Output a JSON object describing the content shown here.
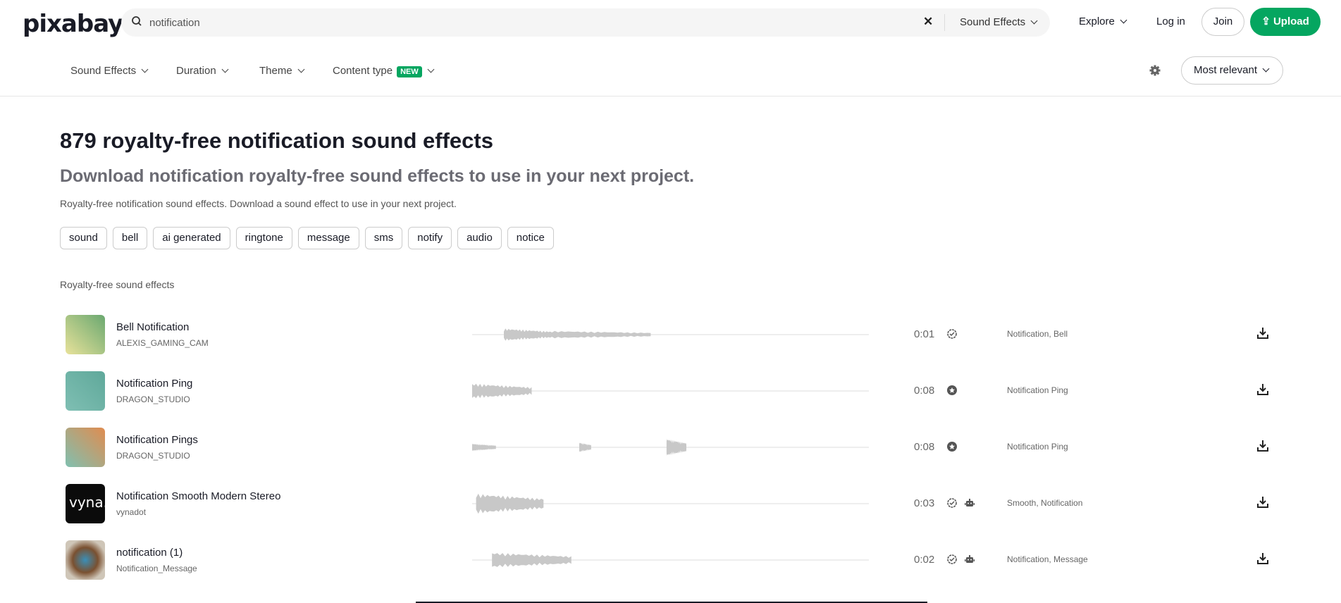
{
  "header": {
    "logo": "pixabay",
    "search_value": "notification",
    "search_category": "Sound Effects",
    "explore": "Explore",
    "login": "Log in",
    "join": "Join",
    "upload": "Upload"
  },
  "filters": {
    "items": [
      "Sound Effects",
      "Duration",
      "Theme",
      "Content type"
    ],
    "new_badge": "NEW",
    "sort": "Most relevant"
  },
  "main": {
    "title": "879 royalty-free notification sound effects",
    "subtitle": "Download notification royalty-free sound effects to use in your next project.",
    "description": "Royalty-free notification sound effects. Download a sound effect to use in your next project.",
    "tags": [
      "sound",
      "bell",
      "ai generated",
      "ringtone",
      "message",
      "sms",
      "notify",
      "audio",
      "notice"
    ],
    "section_label": "Royalty-free sound effects",
    "tracks": [
      {
        "title": "Bell Notification",
        "author": "ALEXIS_GAMING_CAM",
        "duration": "0:01",
        "tags": "Notification, Bell",
        "badge": "verified",
        "ai": false
      },
      {
        "title": "Notification Ping",
        "author": "DRAGON_STUDIO",
        "duration": "0:08",
        "tags": "Notification Ping",
        "badge": "star",
        "ai": false
      },
      {
        "title": "Notification Pings",
        "author": "DRAGON_STUDIO",
        "duration": "0:08",
        "tags": "Notification Ping",
        "badge": "star",
        "ai": false
      },
      {
        "title": "Notification Smooth Modern Stereo",
        "author": "vynadot",
        "duration": "0:03",
        "tags": "Smooth, Notification",
        "badge": "verified",
        "ai": true,
        "thumb_text": "vyna."
      },
      {
        "title": "notification (1)",
        "author": "Notification_Message",
        "duration": "0:02",
        "tags": "Notification, Message",
        "badge": "verified",
        "ai": true
      }
    ]
  },
  "colors": {
    "accent": "#05a660",
    "wave": "#c8c8c8"
  }
}
